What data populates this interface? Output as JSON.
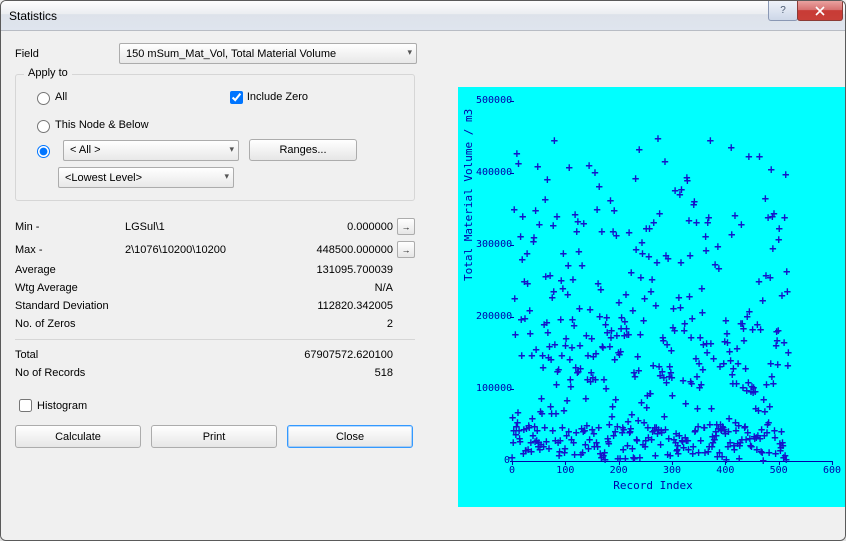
{
  "window": {
    "title": "Statistics"
  },
  "field": {
    "label": "Field",
    "selected": "150 mSum_Mat_Vol, Total Material Volume"
  },
  "apply": {
    "legend": "Apply to",
    "all_label": "All",
    "include_zero_label": "Include Zero",
    "this_node_label": "This Node & Below",
    "filter_selected": "< All >",
    "level_selected": "<Lowest Level>",
    "ranges_btn": "Ranges..."
  },
  "stats_rows": {
    "min": {
      "label": "Min -",
      "mid": "LGSul\\1",
      "val": "0.000000"
    },
    "max": {
      "label": "Max -",
      "mid": "2\\1076\\10200\\10200",
      "val": "448500.000000"
    },
    "avg": {
      "label": "Average",
      "val": "131095.700039"
    },
    "wavg": {
      "label": "Wtg Average",
      "val": "N/A"
    },
    "std": {
      "label": "Standard Deviation",
      "val": "112820.342005"
    },
    "zeros": {
      "label": "No. of Zeros",
      "val": "2"
    },
    "total": {
      "label": "Total",
      "val": "67907572.620100"
    },
    "records": {
      "label": "No of Records",
      "val": "518"
    }
  },
  "histogram_label": "Histogram",
  "buttons": {
    "calculate": "Calculate",
    "print": "Print",
    "close": "Close"
  },
  "chart_data": {
    "type": "scatter",
    "title": "",
    "xlabel": "Record Index",
    "ylabel": "Total Material Volume / m3",
    "xlim": [
      0,
      600
    ],
    "ylim": [
      0,
      500000
    ],
    "xticks": [
      0,
      100,
      200,
      300,
      400,
      500,
      600
    ],
    "yticks": [
      0,
      100000,
      200000,
      300000,
      400000,
      500000
    ],
    "note": "518 points scattered between x=0..518, y mostly 0..450000; dense near y=0; max y≈448500",
    "n_points": 518,
    "x_range": [
      0,
      518
    ],
    "y_max": 448500,
    "y_mean": 131095.7,
    "y_std": 112820.34
  }
}
